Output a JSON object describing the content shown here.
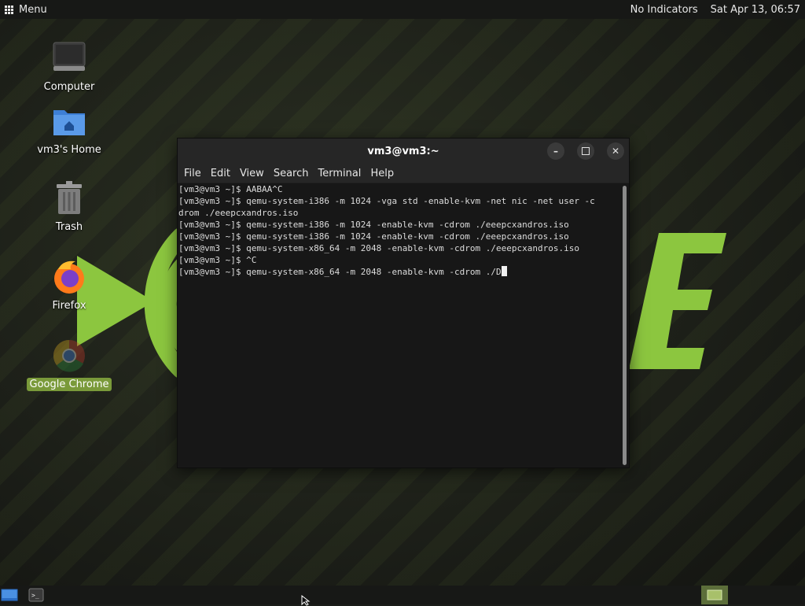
{
  "top_panel": {
    "menu_label": "Menu",
    "indicators_label": "No Indicators",
    "clock": "Sat Apr 13, 06:57"
  },
  "desktop": {
    "icons": [
      {
        "label": "Computer",
        "icon": "computer-icon"
      },
      {
        "label": "vm3's Home",
        "icon": "home-folder-icon"
      },
      {
        "label": "Trash",
        "icon": "trash-icon"
      },
      {
        "label": "Firefox",
        "icon": "firefox-icon"
      },
      {
        "label": "Google Chrome",
        "icon": "chrome-icon",
        "selected": true
      }
    ]
  },
  "terminal": {
    "title": "vm3@vm3:~",
    "menu": [
      "File",
      "Edit",
      "View",
      "Search",
      "Terminal",
      "Help"
    ],
    "lines": [
      "[vm3@vm3 ~]$ AABAA^C",
      "[vm3@vm3 ~]$ qemu-system-i386 -m 1024 -vga std -enable-kvm -net nic -net user -c",
      "drom ./eeepcxandros.iso",
      "[vm3@vm3 ~]$ qemu-system-i386 -m 1024 -enable-kvm -cdrom ./eeepcxandros.iso",
      "[vm3@vm3 ~]$ qemu-system-i386 -m 1024 -enable-kvm -cdrom ./eeepcxandros.iso",
      "[vm3@vm3 ~]$ qemu-system-x86_64 -m 2048 -enable-kvm -cdrom ./eeepcxandros.iso",
      "[vm3@vm3 ~]$ ^C"
    ],
    "current_line": "[vm3@vm3 ~]$ qemu-system-x86_64 -m 2048 -enable-kvm -cdrom ./D"
  },
  "taskbar": {
    "items": [
      "show-desktop-icon",
      "terminal-icon",
      "workspace-switcher-icon"
    ]
  },
  "colors": {
    "accent_green": "#8cc63f",
    "selection_green": "#7a9a3a",
    "panel": "#171816",
    "terminal_bg": "#171717"
  }
}
